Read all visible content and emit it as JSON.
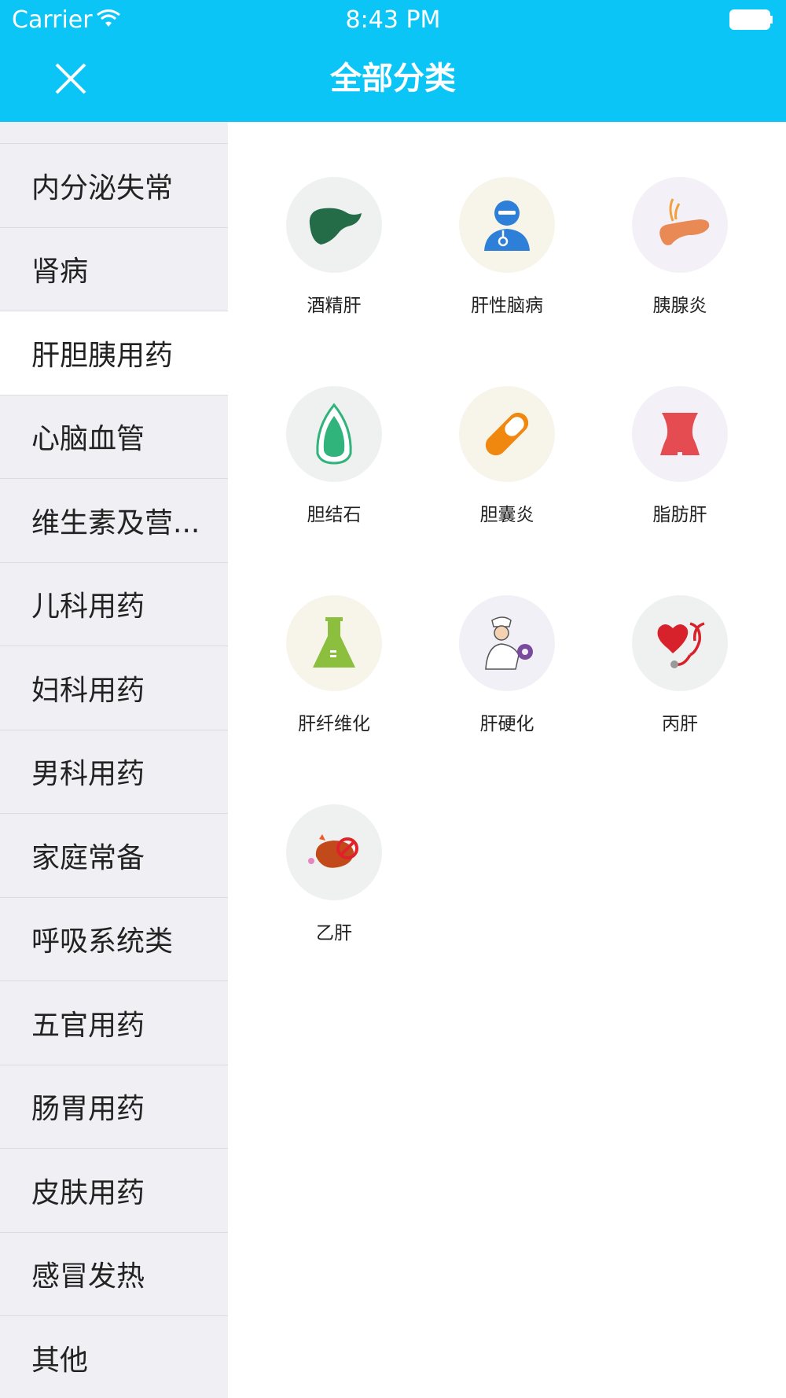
{
  "status_bar": {
    "carrier": "Carrier",
    "time": "8:43 PM"
  },
  "nav": {
    "title": "全部分类",
    "close_icon": "close-icon"
  },
  "colors": {
    "header": "#0ac5f6",
    "sidebar_bg": "#efeff4",
    "active_bg": "#ffffff"
  },
  "sidebar": {
    "items": [
      {
        "label": "内分泌失常"
      },
      {
        "label": "肾病"
      },
      {
        "label": "肝胆胰用药",
        "active": true
      },
      {
        "label": "心脑血管"
      },
      {
        "label": "维生素及营..."
      },
      {
        "label": "儿科用药"
      },
      {
        "label": "妇科用药"
      },
      {
        "label": "男科用药"
      },
      {
        "label": "家庭常备"
      },
      {
        "label": "呼吸系统类"
      },
      {
        "label": "五官用药"
      },
      {
        "label": "肠胃用药"
      },
      {
        "label": "皮肤用药"
      },
      {
        "label": "感冒发热"
      },
      {
        "label": "其他"
      }
    ]
  },
  "categories": [
    {
      "label": "酒精肝",
      "icon": "liver-icon"
    },
    {
      "label": "肝性脑病",
      "icon": "doctor-icon"
    },
    {
      "label": "胰腺炎",
      "icon": "pancreas-icon"
    },
    {
      "label": "胆结石",
      "icon": "gallstone-icon"
    },
    {
      "label": "胆囊炎",
      "icon": "capsule-icon"
    },
    {
      "label": "脂肪肝",
      "icon": "body-icon"
    },
    {
      "label": "肝纤维化",
      "icon": "flask-icon"
    },
    {
      "label": "肝硬化",
      "icon": "nurse-examining-icon"
    },
    {
      "label": "丙肝",
      "icon": "heart-stethoscope-icon"
    },
    {
      "label": "乙肝",
      "icon": "liver-cartoon-icon"
    }
  ]
}
